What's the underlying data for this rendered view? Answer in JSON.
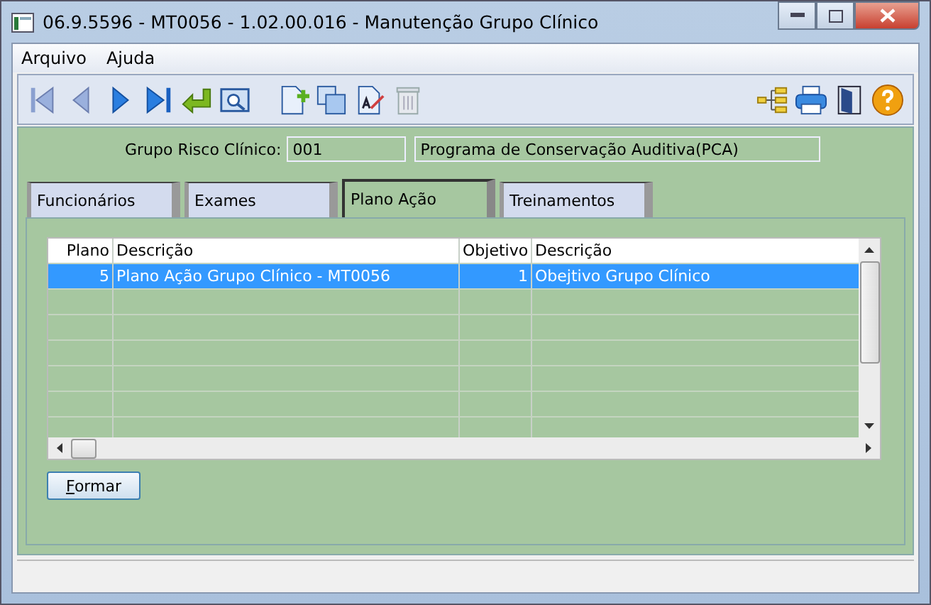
{
  "window": {
    "title": "06.9.5596 - MT0056 - 1.02.00.016 - Manutenção Grupo Clínico"
  },
  "menu": [
    "Arquivo",
    "Ajuda"
  ],
  "header": {
    "label": "Grupo Risco Clínico:",
    "code": "001",
    "description": "Programa de Conservação Auditiva(PCA)"
  },
  "tabs": [
    {
      "label": "Funcionários",
      "selected": false
    },
    {
      "label": "Exames",
      "selected": false
    },
    {
      "label": "Plano Ação",
      "selected": true
    },
    {
      "label": "Treinamentos",
      "selected": false
    }
  ],
  "table": {
    "columns": [
      "Plano",
      "Descrição",
      "Objetivo",
      "Descrição"
    ],
    "rows": [
      {
        "cells": [
          "5",
          "Plano Ação Grupo Clínico - MT0056",
          "1",
          "Obejtivo Grupo Clínico"
        ],
        "selected": true
      }
    ]
  },
  "buttons": [
    "Formar"
  ]
}
